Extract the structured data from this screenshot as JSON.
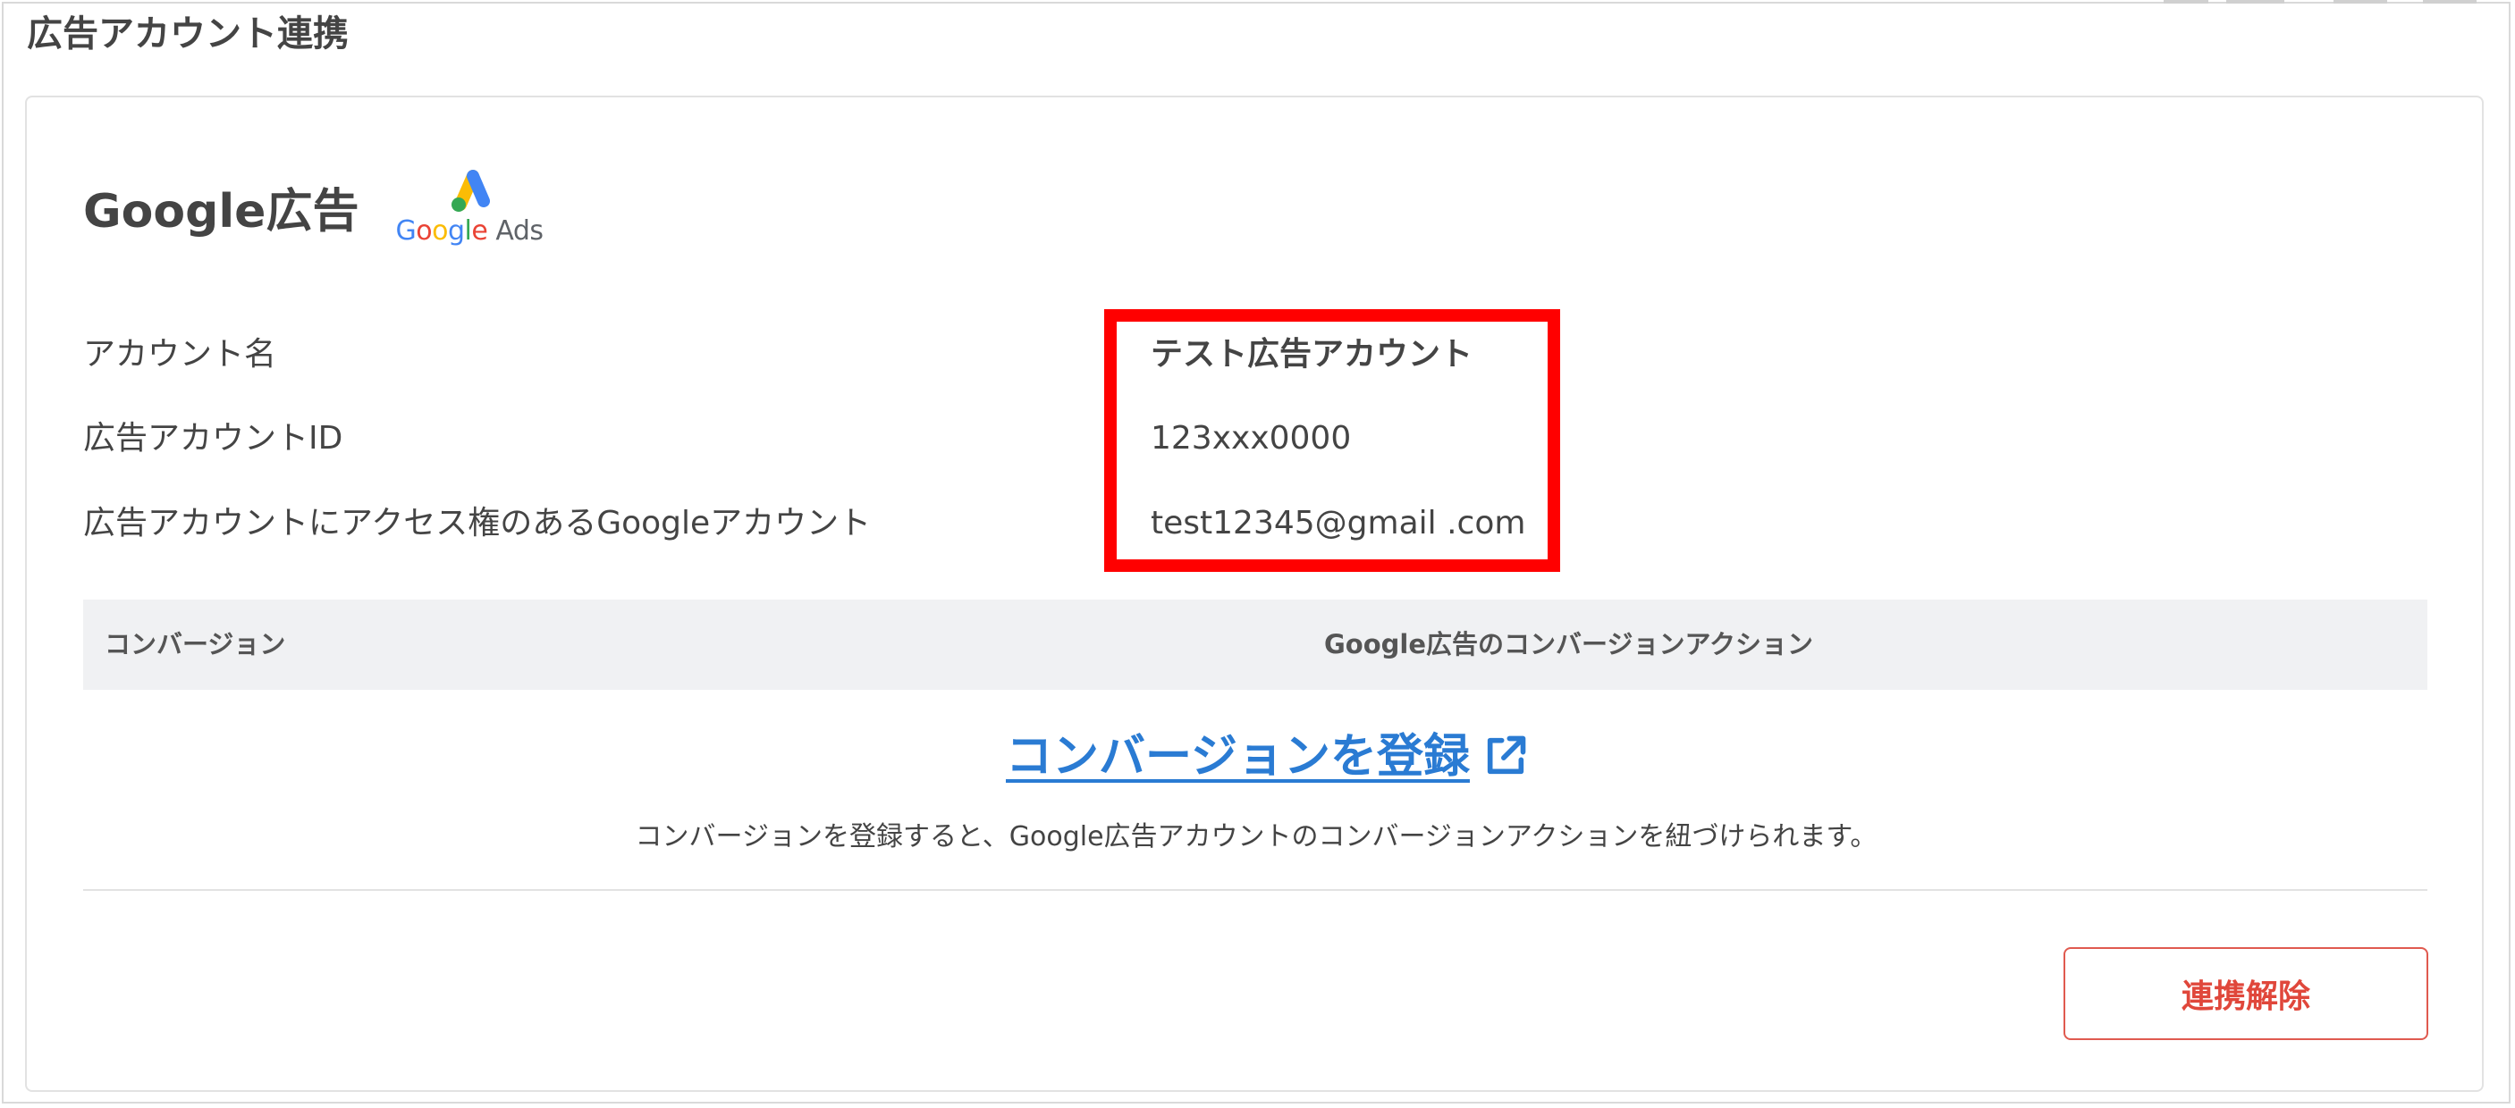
{
  "page": {
    "title": "広告アカウント連携"
  },
  "google_ads": {
    "section_title": "Google広告",
    "logo": {
      "icon": "google-ads-logo-icon",
      "text_letters": [
        "G",
        "o",
        "o",
        "g",
        "l",
        "e"
      ],
      "text_suffix": "Ads"
    },
    "fields": [
      {
        "label": "アカウント名",
        "value": "テスト広告アカウント"
      },
      {
        "label": "広告アカウントID",
        "value": "123xxx0000"
      },
      {
        "label": "広告アカウントにアクセス権のあるGoogleアカウント",
        "value": "test12345@gmail .com"
      }
    ]
  },
  "conversion_table": {
    "columns": [
      "コンバージョン",
      "Google広告のコンバージョンアクション"
    ]
  },
  "register": {
    "link_label": "コンバージョンを登録",
    "link_icon": "external-link-icon",
    "note": "コンバージョンを登録すると、Google広告アカウントのコンバージョンアクションを紐づけられます。"
  },
  "actions": {
    "unlink_label": "連携解除"
  },
  "colors": {
    "highlight": "#ff0000",
    "link": "#2a7bd3",
    "danger": "#e0473b",
    "header_bg": "#f0f1f3"
  }
}
